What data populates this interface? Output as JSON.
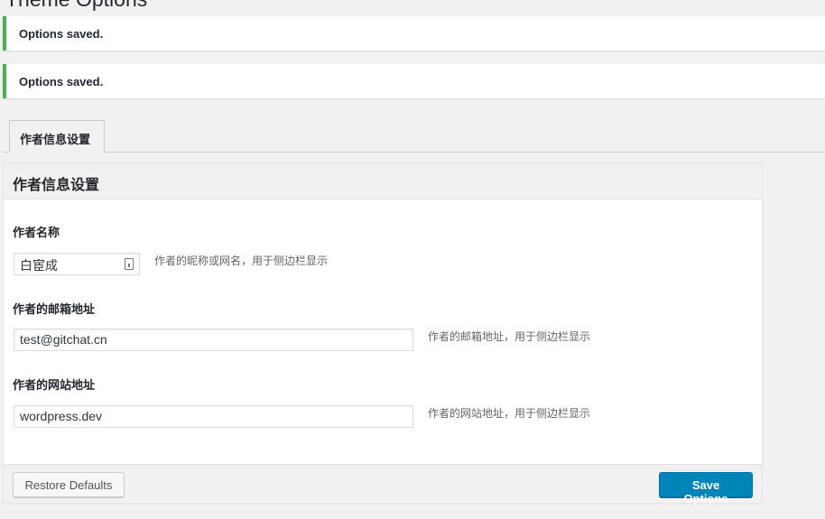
{
  "page": {
    "title": "Theme Options"
  },
  "notices": [
    "Options saved.",
    "Options saved."
  ],
  "tabs": [
    {
      "label": "作者信息设置"
    }
  ],
  "panel": {
    "title": "作者信息设置",
    "fields": [
      {
        "label": "作者名称",
        "value": "白宦成",
        "description": "作者的昵称或网名，用于侧边栏显示"
      },
      {
        "label": "作者的邮箱地址",
        "value": "test@gitchat.cn",
        "description": "作者的邮箱地址，用于侧边栏显示"
      },
      {
        "label": "作者的网站地址",
        "value": "wordpress.dev",
        "description": "作者的网站地址，用于侧边栏显示"
      }
    ],
    "restore_label": "Restore Defaults",
    "save_label": "Save Options"
  },
  "colors": {
    "accent": "#0085ba",
    "success": "#46b450"
  }
}
